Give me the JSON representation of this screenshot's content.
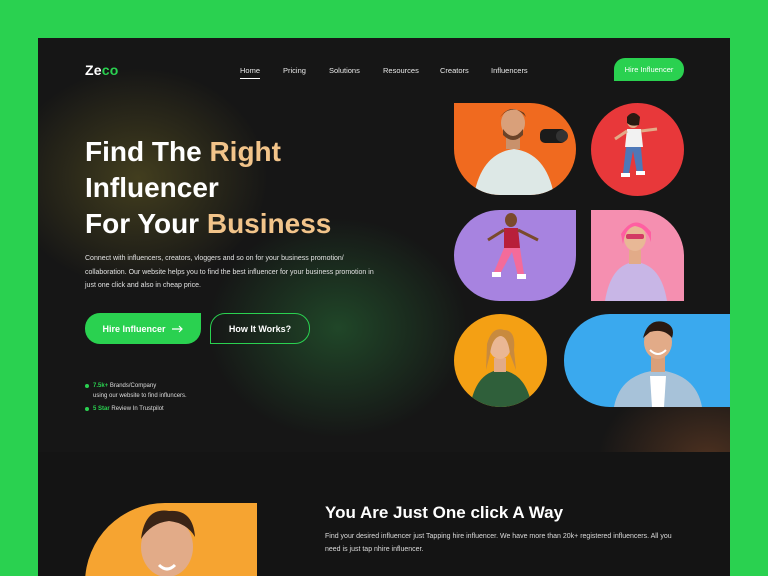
{
  "brand": {
    "logo_main": "Ze",
    "logo_accent": "co",
    "accent_color": "#2ad150"
  },
  "nav": {
    "items": [
      "Home",
      "Pricing",
      "Solutions",
      "Resources",
      "Creators",
      "Influencers"
    ],
    "active": "Home",
    "cta": "Hire Influencer"
  },
  "hero": {
    "line1_white": "Find The ",
    "line1_gold": "Right",
    "line2": "Influencer",
    "line3_white": "For Your ",
    "line3_gold": "Business",
    "description": "Connect with influencers, creators, vloggers and so on for your business promotion/ collaboration. Our website helps you to find the best influencer for your business promotion in just one click  and also in cheap price.",
    "primary_button": "Hire Influencer",
    "primary_button_icon": "arrow-right-icon",
    "secondary_button": "How It Works?",
    "stats": [
      {
        "highlight": "7.5k+",
        "text": " Brands/Company",
        "sub": "using our website to find influncers."
      },
      {
        "highlight": "5 Star",
        "text": " Review In Trustpilot",
        "sub": ""
      }
    ]
  },
  "gallery": {
    "tiles": [
      {
        "name": "influencer-photo-1",
        "bg": "#f06a1f",
        "subject": "man with camera"
      },
      {
        "name": "influencer-photo-2",
        "bg": "#e8383a",
        "subject": "woman jumping"
      },
      {
        "name": "influencer-photo-3",
        "bg": "#a783e0",
        "subject": "man jumping"
      },
      {
        "name": "influencer-photo-4",
        "bg": "#f58fb0",
        "subject": "woman with pink hair"
      },
      {
        "name": "influencer-photo-5",
        "bg": "#f4a014",
        "subject": "woman smiling"
      },
      {
        "name": "influencer-photo-6",
        "bg": "#3aa9ee",
        "subject": "smiling man"
      }
    ]
  },
  "section2": {
    "title": "You Are Just One click A Way",
    "text": "Find your desired influencer just Tapping hire influencer. We have more than 20k+ registered influencers. All you need is just tap nhire influencer.",
    "photo_bg": "#f6a431"
  }
}
